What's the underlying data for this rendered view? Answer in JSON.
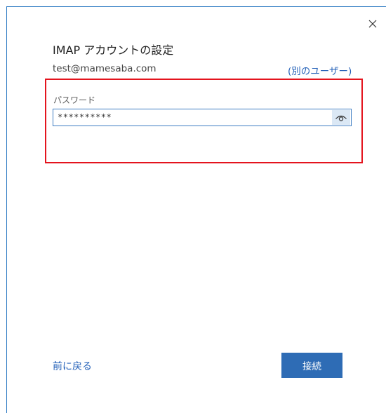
{
  "dialog": {
    "close_icon": "close-icon",
    "title": "IMAP アカウントの設定",
    "email": "test@mamesaba.com",
    "other_user_link": "(別のユーザー)",
    "password": {
      "label": "パスワード",
      "value": "**********",
      "reveal_icon": "eye-icon"
    },
    "back_link": "前に戻る",
    "connect_button": "接続"
  },
  "colors": {
    "accent": "#2e6cb5",
    "link": "#2461b8",
    "highlight": "#e4141e",
    "border": "#2b79c2"
  }
}
